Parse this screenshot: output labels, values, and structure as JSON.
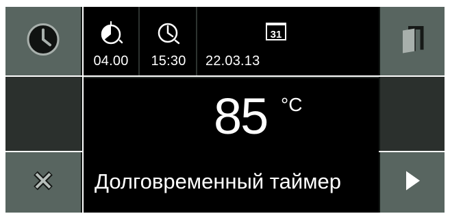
{
  "status": {
    "duration": {
      "icon": "stopwatch-icon",
      "value": "04.00"
    },
    "end_time": {
      "icon": "clock-icon",
      "value": "15:30"
    },
    "date": {
      "icon": "calendar-icon",
      "day": "31",
      "value": "22.03.13"
    }
  },
  "main": {
    "temperature": "85",
    "unit": "°C",
    "program": "Долговременный таймер"
  },
  "buttons": {
    "clock": {
      "icon": "clock-icon"
    },
    "close": {
      "icon": "close-icon"
    },
    "door": {
      "icon": "door-icon"
    },
    "next": {
      "icon": "play-arrow-icon"
    }
  },
  "colors": {
    "screen_bg": "#000000",
    "button_bg": "#586560",
    "button_dark": "#2B302D",
    "text": "#FFFFFF"
  }
}
